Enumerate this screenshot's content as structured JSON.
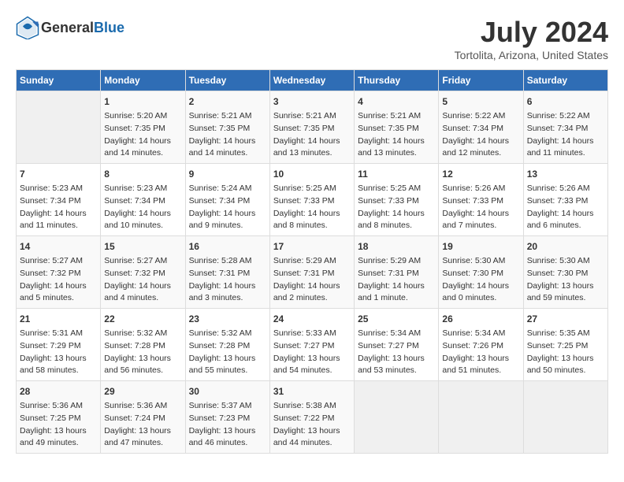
{
  "header": {
    "logo_general": "General",
    "logo_blue": "Blue",
    "title": "July 2024",
    "subtitle": "Tortolita, Arizona, United States"
  },
  "days_of_week": [
    "Sunday",
    "Monday",
    "Tuesday",
    "Wednesday",
    "Thursday",
    "Friday",
    "Saturday"
  ],
  "weeks": [
    [
      {
        "day": "",
        "info": ""
      },
      {
        "day": "1",
        "info": "Sunrise: 5:20 AM\nSunset: 7:35 PM\nDaylight: 14 hours\nand 14 minutes."
      },
      {
        "day": "2",
        "info": "Sunrise: 5:21 AM\nSunset: 7:35 PM\nDaylight: 14 hours\nand 14 minutes."
      },
      {
        "day": "3",
        "info": "Sunrise: 5:21 AM\nSunset: 7:35 PM\nDaylight: 14 hours\nand 13 minutes."
      },
      {
        "day": "4",
        "info": "Sunrise: 5:21 AM\nSunset: 7:35 PM\nDaylight: 14 hours\nand 13 minutes."
      },
      {
        "day": "5",
        "info": "Sunrise: 5:22 AM\nSunset: 7:34 PM\nDaylight: 14 hours\nand 12 minutes."
      },
      {
        "day": "6",
        "info": "Sunrise: 5:22 AM\nSunset: 7:34 PM\nDaylight: 14 hours\nand 11 minutes."
      }
    ],
    [
      {
        "day": "7",
        "info": "Sunrise: 5:23 AM\nSunset: 7:34 PM\nDaylight: 14 hours\nand 11 minutes."
      },
      {
        "day": "8",
        "info": "Sunrise: 5:23 AM\nSunset: 7:34 PM\nDaylight: 14 hours\nand 10 minutes."
      },
      {
        "day": "9",
        "info": "Sunrise: 5:24 AM\nSunset: 7:34 PM\nDaylight: 14 hours\nand 9 minutes."
      },
      {
        "day": "10",
        "info": "Sunrise: 5:25 AM\nSunset: 7:33 PM\nDaylight: 14 hours\nand 8 minutes."
      },
      {
        "day": "11",
        "info": "Sunrise: 5:25 AM\nSunset: 7:33 PM\nDaylight: 14 hours\nand 8 minutes."
      },
      {
        "day": "12",
        "info": "Sunrise: 5:26 AM\nSunset: 7:33 PM\nDaylight: 14 hours\nand 7 minutes."
      },
      {
        "day": "13",
        "info": "Sunrise: 5:26 AM\nSunset: 7:33 PM\nDaylight: 14 hours\nand 6 minutes."
      }
    ],
    [
      {
        "day": "14",
        "info": "Sunrise: 5:27 AM\nSunset: 7:32 PM\nDaylight: 14 hours\nand 5 minutes."
      },
      {
        "day": "15",
        "info": "Sunrise: 5:27 AM\nSunset: 7:32 PM\nDaylight: 14 hours\nand 4 minutes."
      },
      {
        "day": "16",
        "info": "Sunrise: 5:28 AM\nSunset: 7:31 PM\nDaylight: 14 hours\nand 3 minutes."
      },
      {
        "day": "17",
        "info": "Sunrise: 5:29 AM\nSunset: 7:31 PM\nDaylight: 14 hours\nand 2 minutes."
      },
      {
        "day": "18",
        "info": "Sunrise: 5:29 AM\nSunset: 7:31 PM\nDaylight: 14 hours\nand 1 minute."
      },
      {
        "day": "19",
        "info": "Sunrise: 5:30 AM\nSunset: 7:30 PM\nDaylight: 14 hours\nand 0 minutes."
      },
      {
        "day": "20",
        "info": "Sunrise: 5:30 AM\nSunset: 7:30 PM\nDaylight: 13 hours\nand 59 minutes."
      }
    ],
    [
      {
        "day": "21",
        "info": "Sunrise: 5:31 AM\nSunset: 7:29 PM\nDaylight: 13 hours\nand 58 minutes."
      },
      {
        "day": "22",
        "info": "Sunrise: 5:32 AM\nSunset: 7:28 PM\nDaylight: 13 hours\nand 56 minutes."
      },
      {
        "day": "23",
        "info": "Sunrise: 5:32 AM\nSunset: 7:28 PM\nDaylight: 13 hours\nand 55 minutes."
      },
      {
        "day": "24",
        "info": "Sunrise: 5:33 AM\nSunset: 7:27 PM\nDaylight: 13 hours\nand 54 minutes."
      },
      {
        "day": "25",
        "info": "Sunrise: 5:34 AM\nSunset: 7:27 PM\nDaylight: 13 hours\nand 53 minutes."
      },
      {
        "day": "26",
        "info": "Sunrise: 5:34 AM\nSunset: 7:26 PM\nDaylight: 13 hours\nand 51 minutes."
      },
      {
        "day": "27",
        "info": "Sunrise: 5:35 AM\nSunset: 7:25 PM\nDaylight: 13 hours\nand 50 minutes."
      }
    ],
    [
      {
        "day": "28",
        "info": "Sunrise: 5:36 AM\nSunset: 7:25 PM\nDaylight: 13 hours\nand 49 minutes."
      },
      {
        "day": "29",
        "info": "Sunrise: 5:36 AM\nSunset: 7:24 PM\nDaylight: 13 hours\nand 47 minutes."
      },
      {
        "day": "30",
        "info": "Sunrise: 5:37 AM\nSunset: 7:23 PM\nDaylight: 13 hours\nand 46 minutes."
      },
      {
        "day": "31",
        "info": "Sunrise: 5:38 AM\nSunset: 7:22 PM\nDaylight: 13 hours\nand 44 minutes."
      },
      {
        "day": "",
        "info": ""
      },
      {
        "day": "",
        "info": ""
      },
      {
        "day": "",
        "info": ""
      }
    ]
  ]
}
